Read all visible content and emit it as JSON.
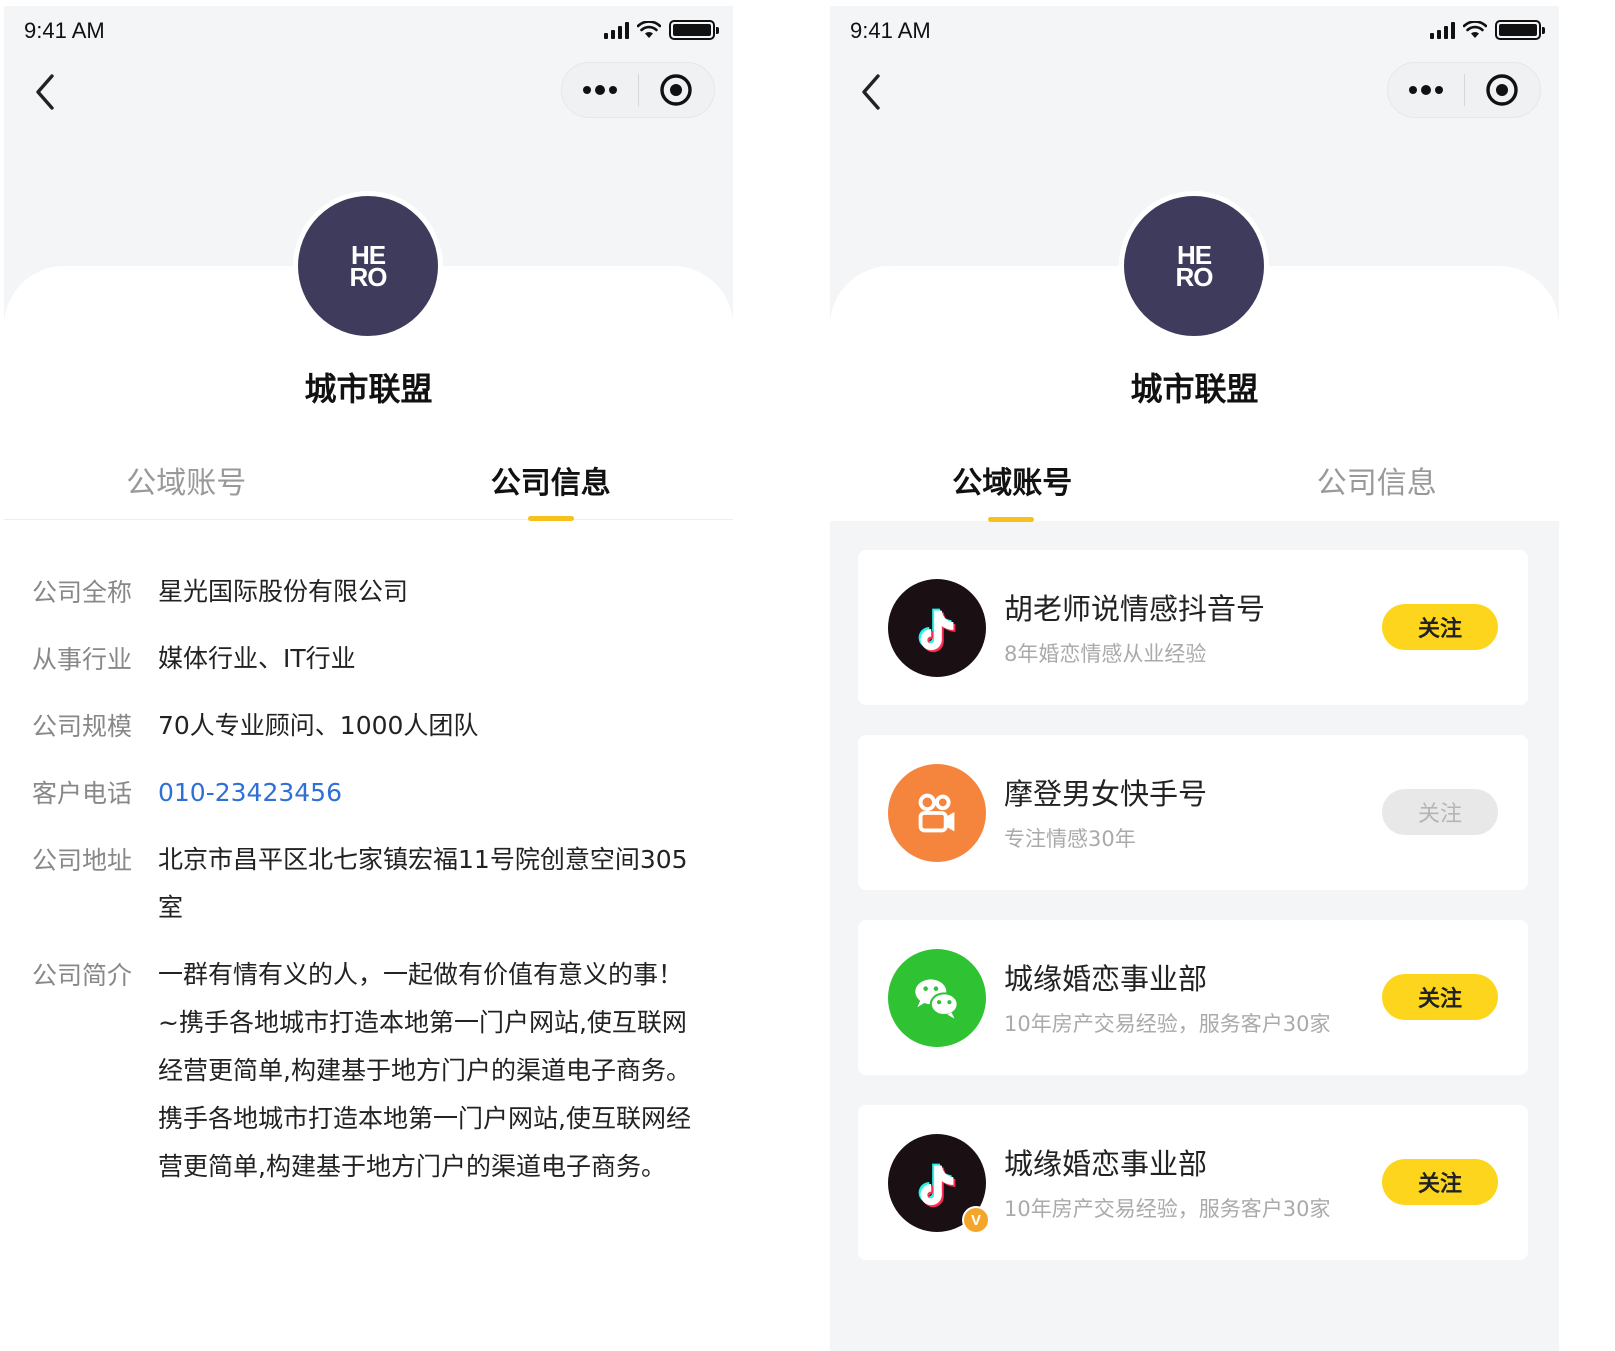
{
  "status_bar": {
    "time": "9:41 AM"
  },
  "profile": {
    "name": "城市联盟",
    "logo_line1": "HE",
    "logo_line2": "RO"
  },
  "tabs": [
    {
      "label": "公域账号"
    },
    {
      "label": "公司信息"
    }
  ],
  "company_info": {
    "full_name_label": "公司全称",
    "full_name": "星光国际股份有限公司",
    "industry_label": "从事行业",
    "industry": "媒体行业、IT行业",
    "scale_label": "公司规模",
    "scale": "70人专业顾问、1000人团队",
    "phone_label": "客户电话",
    "phone": "010-23423456",
    "address_label": "公司地址",
    "address": "北京市昌平区北七家镇宏福11号院创意空间305室",
    "intro_label": "公司简介",
    "intro_p1": "一群有情有义的人，一起做有价值有意义的事！~携手各地城市打造本地第一门户网站,使互联网经营更简单,构建基于地方门户的渠道电子商务。",
    "intro_p2": "携手各地城市打造本地第一门户网站,使互联网经营更简单,构建基于地方门户的渠道电子商务。"
  },
  "accounts": [
    {
      "platform_icon": "tiktok-icon",
      "name": "胡老师说情感抖音号",
      "desc": "8年婚恋情感从业经验",
      "follow": "关注",
      "followed": false,
      "verified": false
    },
    {
      "platform_icon": "kuaishou-icon",
      "name": "摩登男女快手号",
      "desc": "专注情感30年",
      "follow": "关注",
      "followed": true,
      "verified": false
    },
    {
      "platform_icon": "wechat-icon",
      "name": "城缘婚恋事业部",
      "desc": "10年房产交易经验，服务客户30家",
      "follow": "关注",
      "followed": false,
      "verified": false
    },
    {
      "platform_icon": "tiktok-icon",
      "name": "城缘婚恋事业部",
      "desc": "10年房产交易经验，服务客户30家",
      "follow": "关注",
      "followed": false,
      "verified": true,
      "verified_badge": "V"
    }
  ],
  "colors": {
    "accent": "#f6c11c",
    "follow_button": "#fcd51c",
    "link": "#2f6fd8",
    "avatar_bg": "#3e3b5c"
  }
}
